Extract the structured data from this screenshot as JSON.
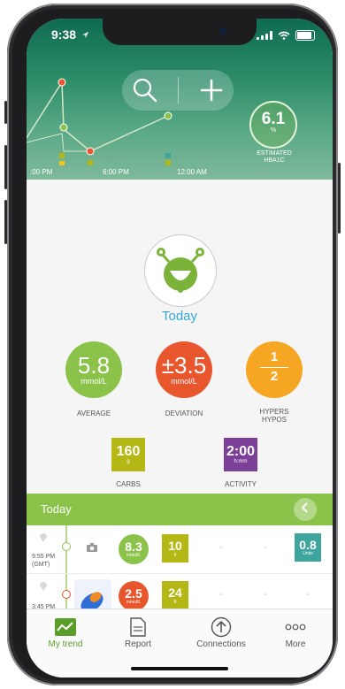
{
  "status": {
    "time": "9:38"
  },
  "header": {
    "axis_labels": [
      ":00 PM",
      "6:00 PM",
      "12:00 AM"
    ],
    "hba1c": {
      "value": "6.1",
      "unit": "%",
      "label_line1": "ESTIMATED",
      "label_line2": "HBA1C"
    }
  },
  "summary": {
    "title": "Today",
    "average": {
      "value": "5.8",
      "unit": "mmol/L",
      "label": "AVERAGE",
      "color": "#8bc34a"
    },
    "deviation": {
      "value": "±3.5",
      "unit": "mmol/L",
      "label": "DEVIATION",
      "color": "#e8562e"
    },
    "hypers": {
      "top": "1",
      "bottom": "2",
      "label_line1": "HYPERS",
      "label_line2": "HYPOS",
      "color": "#f5a623"
    },
    "carbs": {
      "value": "160",
      "unit": "g",
      "label": "CARBS",
      "color": "#b5b714"
    },
    "activity": {
      "value": "2:00",
      "unit": "h:mm",
      "label": "ACTIVITY",
      "color": "#7b3f98"
    }
  },
  "log": {
    "title": "Today",
    "rows": [
      {
        "time": "9:55 PM",
        "tz": "(GMT)",
        "glucose": "8.3",
        "glucose_unit": "mmol/L",
        "carbs": "10",
        "carbs_unit": "g",
        "dash1": "-",
        "dash2": "-",
        "insulin": "0.8",
        "insulin_unit": "Units"
      },
      {
        "time": "3:45 PM",
        "glucose": "2.5",
        "glucose_unit": "mmol/L",
        "carbs": "24",
        "carbs_unit": "g",
        "dash1": "-",
        "dash2": "-",
        "dash3": "-"
      }
    ]
  },
  "tabs": [
    {
      "label": "My trend",
      "icon": "trend-icon",
      "active": true
    },
    {
      "label": "Report",
      "icon": "report-icon"
    },
    {
      "label": "Connections",
      "icon": "connections-icon"
    },
    {
      "label": "More",
      "icon": "more-icon"
    }
  ],
  "colors": {
    "accent": "#8bc34a",
    "title": "#36a8d8"
  }
}
